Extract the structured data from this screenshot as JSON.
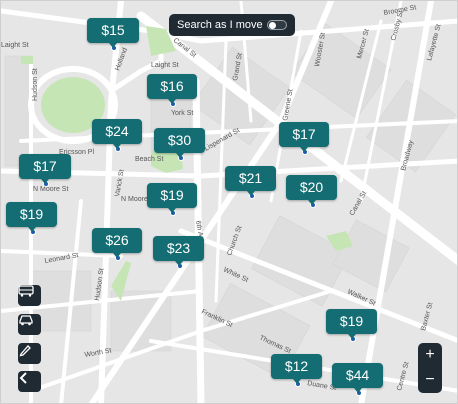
{
  "search_toggle": {
    "label": "Search as I move",
    "enabled": false
  },
  "price_pins": [
    "$15",
    "$16",
    "$24",
    "$30",
    "$17",
    "$17",
    "$21",
    "$20",
    "$19",
    "$19",
    "$26",
    "$23",
    "$19",
    "$12",
    "$44"
  ],
  "streets": {
    "laight_st_w": "Laight St",
    "hudson_st": "Hudson St",
    "laight_st": "Laight St",
    "canal_st_top": "Canal St",
    "holland": "Holland",
    "york_st": "York St",
    "beach_st": "Beach St",
    "ericsson_pl": "Ericsson Pl",
    "varick_st": "Varick St",
    "n_moore_st": "N Moore St",
    "n_moore_st_2": "N Moore St",
    "avenue_6th": "6th Ave",
    "church_st": "Church St",
    "lispenard_st": "Lispenard St",
    "walker_st": "Walker St",
    "canal_st": "Canal St",
    "broadway": "Broadway",
    "white_st": "White St",
    "franklin_st": "Franklin St",
    "leonard_st": "Leonard St",
    "worth_st": "Worth St",
    "hudson_st_2": "Hudson St",
    "greene_st": "Greene St",
    "grand_st": "Grand St",
    "wooster_st": "Wooster St",
    "mercer_st": "Mercer St",
    "crosby_st": "Crosby St",
    "lafayette_st": "Lafayette St",
    "broome_st": "Broome St",
    "thomas_st": "Thomas St",
    "duane_st": "Duane St",
    "baxter_st": "Baxter St",
    "centre_st": "Centre St"
  },
  "tools": [
    "bus-icon",
    "car-icon",
    "pencil-icon",
    "back-arrow-icon"
  ],
  "zoom": {
    "in": "+",
    "out": "−"
  },
  "colors": {
    "pin": "#136d73",
    "toolbar": "#1f2a33",
    "park": "#c6e5b5"
  }
}
